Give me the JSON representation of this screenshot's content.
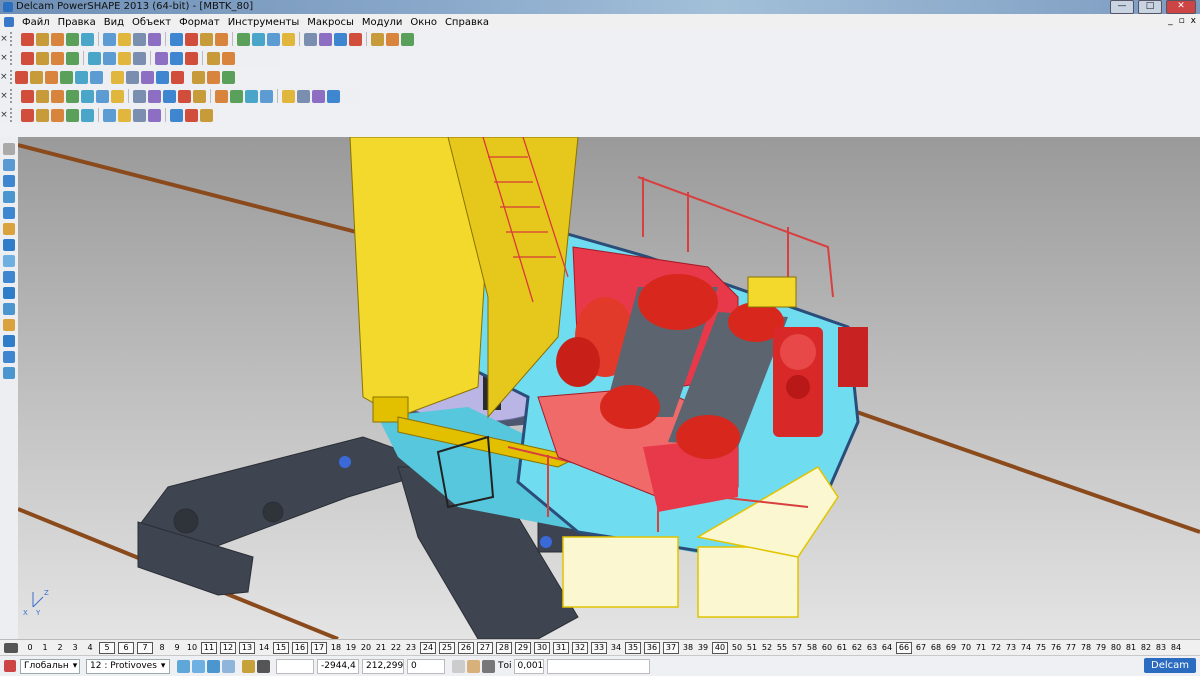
{
  "window": {
    "title": "Delcam PowerSHAPE 2013 (64-bit) - [MBTK_80]",
    "minimize": "—",
    "maximize": "□",
    "close": "✕"
  },
  "menu": {
    "items": [
      "Файл",
      "Правка",
      "Вид",
      "Объект",
      "Формат",
      "Инструменты",
      "Макросы",
      "Модули",
      "Окно",
      "Справка"
    ],
    "mdi_minimize": "_",
    "mdi_restore": "▫",
    "mdi_close": "x"
  },
  "toolbars": {
    "close_glyph": "×",
    "row1_count": 24,
    "row2_count": 13,
    "row3_count": 14,
    "row4_count": 20,
    "row5_count": 12
  },
  "levels": {
    "items": [
      "0",
      "1",
      "2",
      "3",
      "4",
      "5",
      "6",
      "7",
      "8",
      "9",
      "10",
      "11",
      "12",
      "13",
      "14",
      "15",
      "16",
      "17",
      "18",
      "19",
      "20",
      "21",
      "22",
      "23",
      "24",
      "25",
      "26",
      "27",
      "28",
      "29",
      "30",
      "31",
      "32",
      "33",
      "34",
      "35",
      "36",
      "37",
      "38",
      "39",
      "40",
      "50",
      "51",
      "52",
      "55",
      "57",
      "58",
      "60",
      "61",
      "62",
      "63",
      "64",
      "66",
      "67",
      "68",
      "69",
      "70",
      "71",
      "72",
      "73",
      "74",
      "75",
      "76",
      "77",
      "78",
      "79",
      "80",
      "81",
      "82",
      "83",
      "84"
    ],
    "active": [
      "5",
      "6",
      "7",
      "11",
      "12",
      "13",
      "15",
      "16",
      "17",
      "24",
      "25",
      "26",
      "27",
      "28",
      "29",
      "30",
      "31",
      "32",
      "33",
      "35",
      "36",
      "37",
      "40",
      "66"
    ]
  },
  "status": {
    "workplane": "Глобальн",
    "level": "12 : Protivoves",
    "x": "-2944,4",
    "y": "212,299",
    "z": "0",
    "tolerance_label": "Тоі",
    "tolerance": "0,001",
    "logo": "Delcam"
  },
  "colors": {
    "viewport_top": "#9c9c9c",
    "viewport_bottom": "#e0e0e0",
    "crane_yellow": "#f2d92c",
    "winch_red": "#e8394a",
    "deck_cyan": "#6fdcf0",
    "rail_brown": "#8a4a1c",
    "chassis_dark": "#3f4550"
  }
}
